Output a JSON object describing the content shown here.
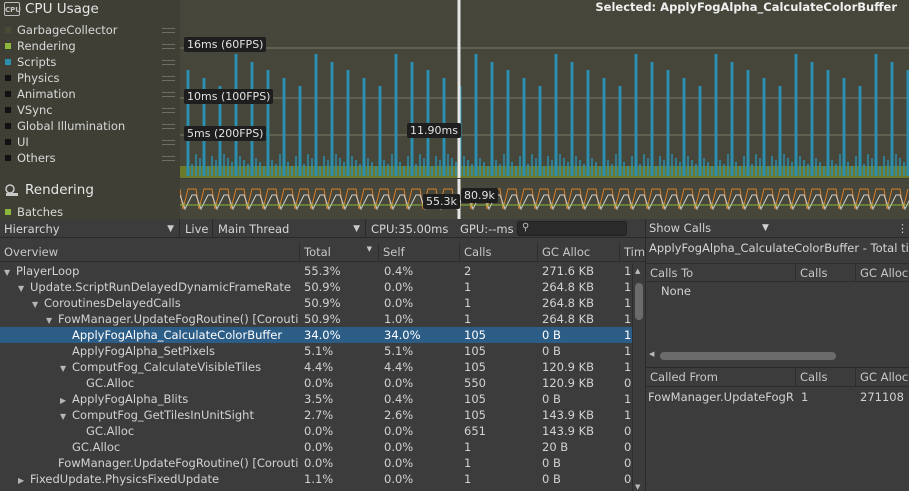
{
  "cpu": {
    "title": "CPU Usage",
    "icon_text": "CPU",
    "legend": [
      {
        "label": "GarbageCollector",
        "color": "#4b4b33"
      },
      {
        "label": "Rendering",
        "color": "#8cb63c"
      },
      {
        "label": "Scripts",
        "color": "#2b8fb0"
      },
      {
        "label": "Physics",
        "color": "#111111"
      },
      {
        "label": "Animation",
        "color": "#111111"
      },
      {
        "label": "VSync",
        "color": "#111111"
      },
      {
        "label": "Global Illumination",
        "color": "#111111"
      },
      {
        "label": "UI",
        "color": "#111111"
      },
      {
        "label": "Others",
        "color": "#111111"
      }
    ],
    "markers": [
      "16ms (60FPS)",
      "10ms (100FPS)",
      "5ms (200FPS)"
    ],
    "cursor_value": "11.90ms",
    "selected": "Selected: ApplyFogAlpha_CalculateColorBuffer"
  },
  "rendering": {
    "title": "Rendering",
    "legend_batches": "Batches",
    "value_a": "55.3k",
    "value_b": "80.9k"
  },
  "toolbar": {
    "view": "Hierarchy",
    "live": "Live",
    "thread": "Main Thread",
    "cpu_time": "CPU:35.00ms",
    "gpu_time": "GPU:--ms",
    "search_placeholder": "",
    "show_calls": "Show Calls"
  },
  "columns": {
    "overview": "Overview",
    "total": "Total",
    "self": "Self",
    "calls": "Calls",
    "gc_alloc": "GC Alloc",
    "time": "Tim"
  },
  "rows": [
    {
      "name": "PlayerLoop",
      "indent": 0,
      "tri": "▼",
      "total": "55.3%",
      "self": "0.4%",
      "calls": "2",
      "gc": "271.6 KB",
      "time": "1",
      "selected": false
    },
    {
      "name": "Update.ScriptRunDelayedDynamicFrameRate",
      "indent": 1,
      "tri": "▼",
      "total": "50.9%",
      "self": "0.0%",
      "calls": "1",
      "gc": "264.8 KB",
      "time": "1",
      "selected": false
    },
    {
      "name": "CoroutinesDelayedCalls",
      "indent": 2,
      "tri": "▼",
      "total": "50.9%",
      "self": "0.0%",
      "calls": "1",
      "gc": "264.8 KB",
      "time": "1",
      "selected": false
    },
    {
      "name": "FowManager.UpdateFogRoutine() [Corouti",
      "indent": 3,
      "tri": "▼",
      "total": "50.9%",
      "self": "1.0%",
      "calls": "1",
      "gc": "264.8 KB",
      "time": "1",
      "selected": false
    },
    {
      "name": "ApplyFogAlpha_CalculateColorBuffer",
      "indent": 4,
      "tri": "",
      "total": "34.0%",
      "self": "34.0%",
      "calls": "105",
      "gc": "0 B",
      "time": "1",
      "selected": true
    },
    {
      "name": "ApplyFogAlpha_SetPixels",
      "indent": 4,
      "tri": "",
      "total": "5.1%",
      "self": "5.1%",
      "calls": "105",
      "gc": "0 B",
      "time": "1",
      "selected": false
    },
    {
      "name": "ComputFog_CalculateVisibleTiles",
      "indent": 4,
      "tri": "▼",
      "total": "4.4%",
      "self": "4.4%",
      "calls": "105",
      "gc": "120.9 KB",
      "time": "1",
      "selected": false
    },
    {
      "name": "GC.Alloc",
      "indent": 5,
      "tri": "",
      "total": "0.0%",
      "self": "0.0%",
      "calls": "550",
      "gc": "120.9 KB",
      "time": "0",
      "selected": false
    },
    {
      "name": "ApplyFogAlpha_Blits",
      "indent": 4,
      "tri": "▶",
      "total": "3.5%",
      "self": "0.4%",
      "calls": "105",
      "gc": "0 B",
      "time": "1",
      "selected": false
    },
    {
      "name": "ComputFog_GetTilesInUnitSight",
      "indent": 4,
      "tri": "▼",
      "total": "2.7%",
      "self": "2.6%",
      "calls": "105",
      "gc": "143.9 KB",
      "time": "1",
      "selected": false
    },
    {
      "name": "GC.Alloc",
      "indent": 5,
      "tri": "",
      "total": "0.0%",
      "self": "0.0%",
      "calls": "651",
      "gc": "143.9 KB",
      "time": "0",
      "selected": false
    },
    {
      "name": "GC.Alloc",
      "indent": 4,
      "tri": "",
      "total": "0.0%",
      "self": "0.0%",
      "calls": "1",
      "gc": "20 B",
      "time": "0",
      "selected": false
    },
    {
      "name": "FowManager.UpdateFogRoutine() [Corouti",
      "indent": 3,
      "tri": "",
      "total": "0.0%",
      "self": "0.0%",
      "calls": "1",
      "gc": "0 B",
      "time": "0",
      "selected": false
    },
    {
      "name": "FixedUpdate.PhysicsFixedUpdate",
      "indent": 1,
      "tri": "▶",
      "total": "1.1%",
      "self": "0.0%",
      "calls": "1",
      "gc": "0 B",
      "time": "0",
      "selected": false
    }
  ],
  "details": {
    "header": "ApplyFogAlpha_CalculateColorBuffer - Total tim",
    "calls_to": "Calls To",
    "calls_col": "Calls",
    "gc_col": "GC Alloc",
    "none": "None",
    "called_from": "Called From",
    "called_from_row": {
      "name": "FowManager.UpdateFogR",
      "calls": "1",
      "gc": "271108"
    }
  },
  "colors": {
    "selection": "#2c5d87",
    "scripts": "#2b8fb0",
    "rendering": "#8cb63c"
  }
}
